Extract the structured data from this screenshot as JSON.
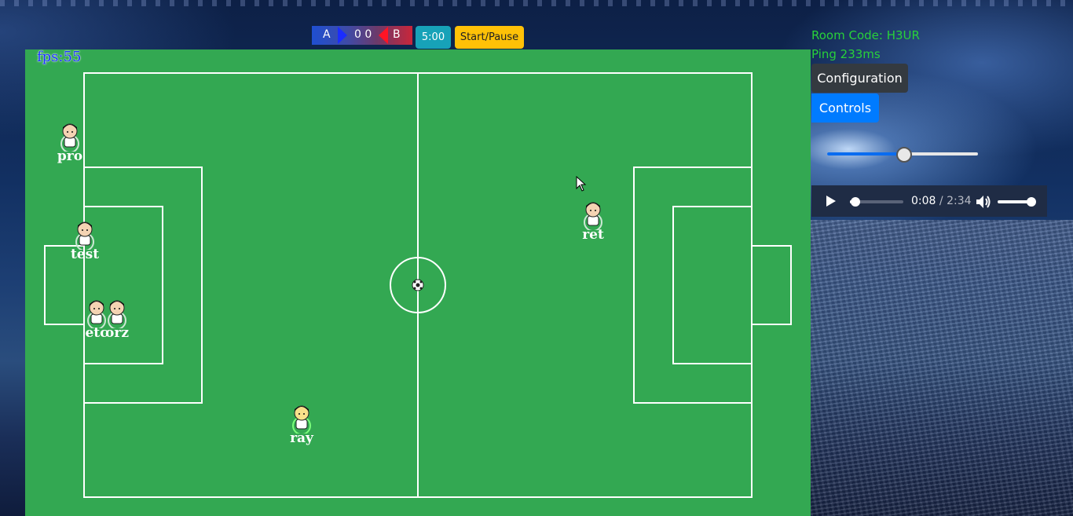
{
  "scoreboard": {
    "team_a": "A",
    "score": "0 0",
    "team_b": "B",
    "timer_label": "5:00",
    "start_pause_label": "Start/Pause"
  },
  "game": {
    "fps_text": "fps:55",
    "players": [
      "pro",
      "test",
      "etc",
      "orz",
      "ray",
      "ret"
    ],
    "colors": {
      "pitch": "#33a852",
      "lines": "#ffffff",
      "team_a": "#1a2cff",
      "team_b": "#ff1424"
    }
  },
  "sidebar": {
    "room_code": "Room Code: H3UR",
    "ping": "Ping 233ms",
    "config_label": "Configuration",
    "controls_label": "Controls",
    "slider_value": 0.5
  },
  "audio": {
    "current_time": "0:08",
    "separator": " / ",
    "duration": "2:34",
    "progress": 0.05,
    "volume": 0.8,
    "icons": [
      "play-icon",
      "volume-icon"
    ]
  }
}
